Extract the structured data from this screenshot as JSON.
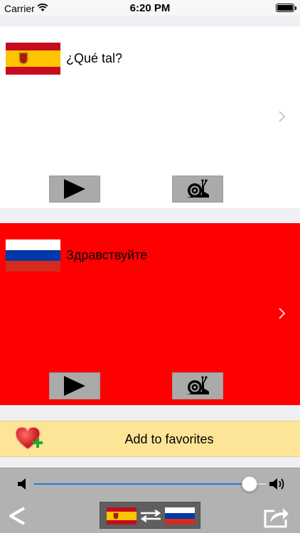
{
  "status_bar": {
    "carrier": "Carrier",
    "time": "6:20 PM"
  },
  "source": {
    "language": "Spanish",
    "flag_icon": "spain-flag-icon",
    "phrase": "¿Qué tal?"
  },
  "target": {
    "language": "Russian",
    "flag_icon": "russia-flag-icon",
    "phrase": "Здравствуйте"
  },
  "favorites": {
    "label": "Add to favorites"
  },
  "volume": {
    "level": 0.93
  },
  "icons": {
    "play": "play-icon",
    "slow": "snail-icon",
    "back": "back-chevron-icon",
    "swap": "swap-arrows-icon",
    "share": "share-icon"
  },
  "colors": {
    "target_panel": "#ff0000",
    "favorites_bar": "#fce597",
    "slider_fill": "#1a7fe0"
  }
}
